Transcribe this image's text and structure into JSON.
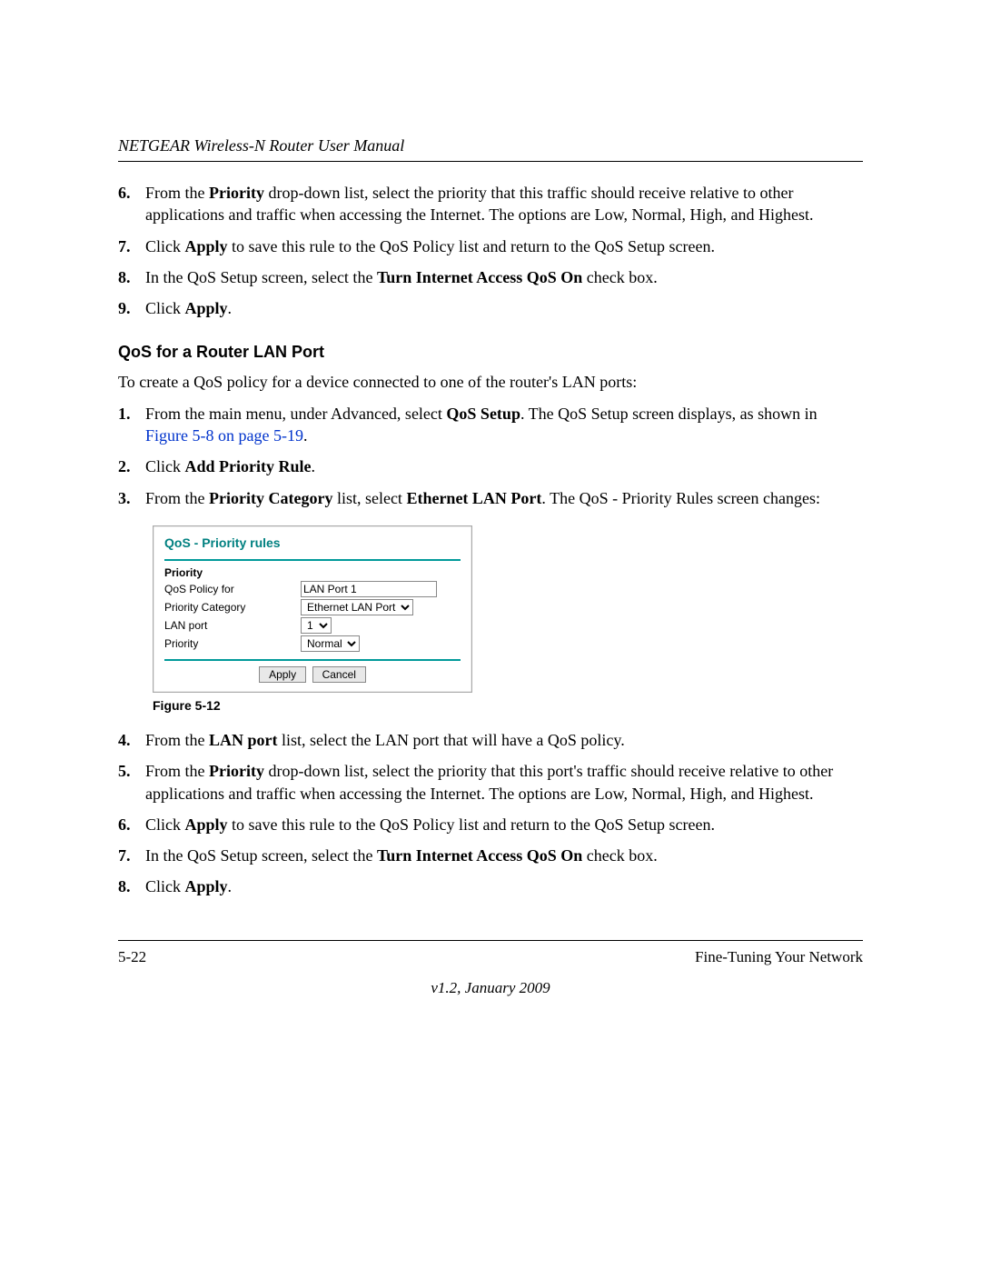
{
  "header": {
    "manual_title": "NETGEAR Wireless-N Router User Manual"
  },
  "top_steps": [
    {
      "n": "6.",
      "pre": "From the ",
      "b1": "Priority",
      "post": " drop-down list, select the priority that this traffic should receive relative to other applications and traffic when accessing the Internet. The options are Low, Normal, High, and Highest."
    },
    {
      "n": "7.",
      "pre": "Click ",
      "b1": "Apply",
      "post": " to save this rule to the QoS Policy list and return to the QoS Setup screen."
    },
    {
      "n": "8.",
      "pre": "In the QoS Setup screen, select the ",
      "b1": "Turn Internet Access QoS On",
      "post": " check box."
    },
    {
      "n": "9.",
      "pre": "Click ",
      "b1": "Apply",
      "post": "."
    }
  ],
  "subhead": "QoS for a Router LAN Port",
  "lead": "To create a QoS policy for a device connected to one of the router's LAN ports:",
  "mid_steps_a": {
    "s1": {
      "n": "1.",
      "pre": "From the main menu, under Advanced, select ",
      "b1": "QoS Setup",
      "mid": ". The QoS Setup screen displays, as shown in ",
      "link": "Figure 5-8 on page 5-19",
      "post": "."
    },
    "s2": {
      "n": "2.",
      "pre": "Click ",
      "b1": "Add Priority Rule",
      "post": "."
    },
    "s3": {
      "n": "3.",
      "pre": "From the ",
      "b1": "Priority Category",
      "mid": " list, select ",
      "b2": "Ethernet LAN Port",
      "post": ". The QoS - Priority Rules screen changes:"
    }
  },
  "ui": {
    "title": "QoS - Priority rules",
    "section": "Priority",
    "rows": {
      "policy_for": {
        "label": "QoS Policy for",
        "value": "LAN Port 1"
      },
      "category": {
        "label": "Priority Category",
        "value": "Ethernet LAN Port"
      },
      "lan_port": {
        "label": "LAN port",
        "value": "1"
      },
      "priority": {
        "label": "Priority",
        "value": "Normal"
      }
    },
    "buttons": {
      "apply": "Apply",
      "cancel": "Cancel"
    }
  },
  "figure_caption": "Figure 5-12",
  "bottom_steps": {
    "s4": {
      "n": "4.",
      "pre": "From the ",
      "b1": "LAN port",
      "post": " list, select the LAN port that will have a QoS policy."
    },
    "s5": {
      "n": "5.",
      "pre": "From the ",
      "b1": "Priority",
      "post": " drop-down list, select the priority that this port's traffic should receive relative to other applications and traffic when accessing the Internet. The options are Low, Normal, High, and Highest."
    },
    "s6": {
      "n": "6.",
      "pre": "Click ",
      "b1": "Apply",
      "post": " to save this rule to the QoS Policy list and return to the QoS Setup screen."
    },
    "s7": {
      "n": "7.",
      "pre": "In the QoS Setup screen, select the ",
      "b1": "Turn Internet Access QoS On",
      "post": " check box."
    },
    "s8": {
      "n": "8.",
      "pre": "Click ",
      "b1": "Apply",
      "post": "."
    }
  },
  "footer": {
    "page": "5-22",
    "section": "Fine-Tuning Your Network",
    "version": "v1.2, January 2009"
  }
}
